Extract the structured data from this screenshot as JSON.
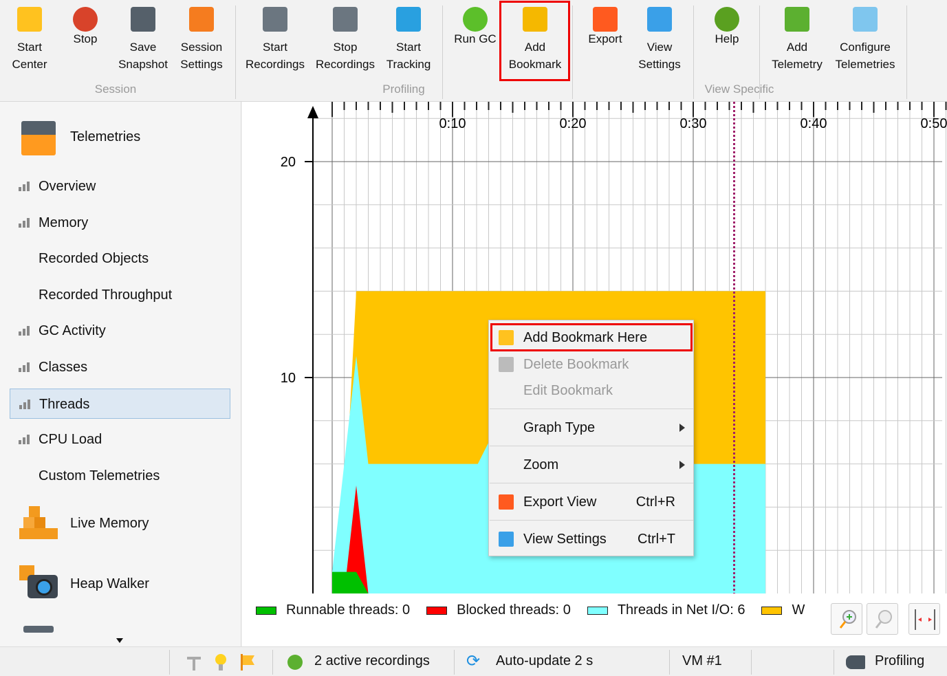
{
  "toolbar": {
    "buttons": [
      {
        "l1": "Start",
        "l2": "Center",
        "icon": "start-center-icon"
      },
      {
        "l1": "",
        "l2": "Stop",
        "icon": "stop-icon"
      },
      {
        "l1": "Save",
        "l2": "Snapshot",
        "icon": "save-icon"
      },
      {
        "l1": "Session",
        "l2": "Settings",
        "icon": "session-settings-icon"
      },
      {
        "l1": "Start",
        "l2": "Recordings",
        "icon": "start-recordings-icon"
      },
      {
        "l1": "Stop",
        "l2": "Recordings",
        "icon": "stop-recordings-icon"
      },
      {
        "l1": "Start",
        "l2": "Tracking",
        "icon": "start-tracking-icon"
      },
      {
        "l1": "",
        "l2": "Run GC",
        "icon": "run-gc-icon"
      },
      {
        "l1": "Add",
        "l2": "Bookmark",
        "icon": "add-bookmark-icon"
      },
      {
        "l1": "",
        "l2": "Export",
        "icon": "export-icon"
      },
      {
        "l1": "View",
        "l2": "Settings",
        "icon": "view-settings-icon"
      },
      {
        "l1": "",
        "l2": "Help",
        "icon": "help-icon"
      },
      {
        "l1": "Add",
        "l2": "Telemetry",
        "icon": "add-telemetry-icon"
      },
      {
        "l1": "Configure",
        "l2": "Telemetries",
        "icon": "configure-telemetries-icon"
      }
    ],
    "groups": [
      "Session",
      "Profiling",
      "View Specific"
    ]
  },
  "sidebar": {
    "header": "Telemetries",
    "items": [
      {
        "label": "Overview",
        "bars": true
      },
      {
        "label": "Memory",
        "bars": true
      },
      {
        "label": "Recorded Objects",
        "bars": false
      },
      {
        "label": "Recorded Throughput",
        "bars": false
      },
      {
        "label": "GC Activity",
        "bars": true
      },
      {
        "label": "Classes",
        "bars": true
      },
      {
        "label": "Threads",
        "bars": true,
        "selected": true
      },
      {
        "label": "CPU Load",
        "bars": true
      },
      {
        "label": "Custom Telemetries",
        "bars": false
      }
    ],
    "sections": [
      "Live Memory",
      "Heap Walker"
    ]
  },
  "chart_data": {
    "type": "area",
    "title": "Threads",
    "x_unit": "seconds",
    "x_ticks": [
      {
        "t": 10,
        "label": "0:10"
      },
      {
        "t": 20,
        "label": "0:20"
      },
      {
        "t": 30,
        "label": "0:30"
      },
      {
        "t": 40,
        "label": "0:40"
      },
      {
        "t": 50,
        "label": "0:50"
      }
    ],
    "y_ticks": [
      {
        "v": 10,
        "label": "10"
      },
      {
        "v": 20,
        "label": "20"
      }
    ],
    "xlim": [
      0,
      51
    ],
    "ylim": [
      0,
      22
    ],
    "bookmark_t": 33.4,
    "series": [
      {
        "name": "Waiting threads",
        "color": "#ffc400",
        "top": [
          [
            0,
            1
          ],
          [
            1,
            3.5
          ],
          [
            2,
            14
          ],
          [
            36,
            14
          ],
          [
            36,
            0
          ]
        ]
      },
      {
        "name": "Threads in Net I/O",
        "color": "#80ffff",
        "top": [
          [
            0,
            1
          ],
          [
            2,
            11
          ],
          [
            3,
            6
          ],
          [
            12.1,
            6
          ],
          [
            13,
            7
          ],
          [
            30,
            6
          ],
          [
            36,
            6
          ],
          [
            36,
            0
          ]
        ]
      },
      {
        "name": "Blocked threads",
        "color": "#ff0000",
        "top": [
          [
            1.2,
            1
          ],
          [
            2,
            5
          ],
          [
            3,
            0
          ]
        ]
      },
      {
        "name": "Runnable threads",
        "color": "#00c000",
        "top": [
          [
            0,
            1
          ],
          [
            2,
            1
          ],
          [
            3,
            0
          ]
        ]
      }
    ]
  },
  "legend": [
    {
      "label": "Runnable threads:",
      "value": "0",
      "color": "#00c000"
    },
    {
      "label": "Blocked threads:",
      "value": "0",
      "color": "#ff0000"
    },
    {
      "label": "Threads in Net I/O:",
      "value": "6",
      "color": "#80ffff"
    },
    {
      "label": "W",
      "value": "",
      "color": "#ffc400"
    }
  ],
  "context_menu": {
    "items": [
      {
        "label": "Add Bookmark Here",
        "shortcut": ""
      },
      {
        "label": "Delete Bookmark",
        "shortcut": ""
      },
      {
        "label": "Edit Bookmark",
        "shortcut": ""
      },
      {
        "label": "Graph Type",
        "shortcut": ""
      },
      {
        "label": "Zoom",
        "shortcut": ""
      },
      {
        "label": "Export View",
        "shortcut": "Ctrl+R"
      },
      {
        "label": "View Settings",
        "shortcut": "Ctrl+T"
      }
    ]
  },
  "status": {
    "recordings": "2 active recordings",
    "autoupdate": "Auto-update 2 s",
    "vm": "VM #1",
    "mode": "Profiling"
  }
}
